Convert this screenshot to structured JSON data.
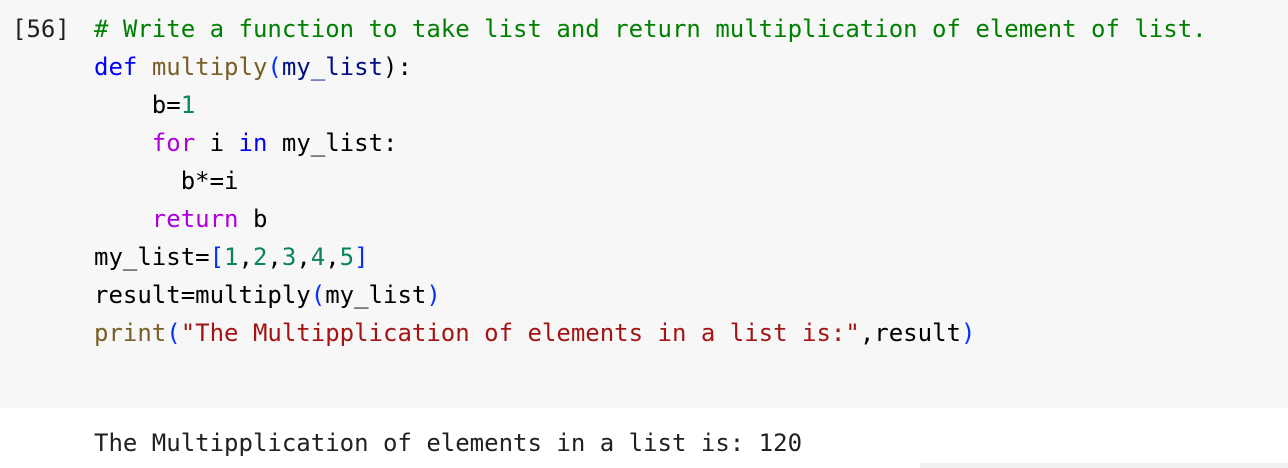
{
  "cell": {
    "execution_count": "[56]",
    "lines": [
      [
        {
          "t": "# Write a function to take list and return multiplication of element of list.",
          "c": "comment"
        }
      ],
      [
        {
          "t": "def",
          "c": "kw-def"
        },
        {
          "t": " ",
          "c": "plain"
        },
        {
          "t": "multiply",
          "c": "fn"
        },
        {
          "t": "(",
          "c": "punct"
        },
        {
          "t": "my_list",
          "c": "var"
        },
        {
          "t": "):",
          "c": "plain"
        }
      ],
      [
        {
          "t": "    ",
          "c": "plain"
        },
        {
          "t": "b",
          "c": "plain"
        },
        {
          "t": "=",
          "c": "plain"
        },
        {
          "t": "1",
          "c": "num"
        }
      ],
      [
        {
          "t": "    ",
          "c": "plain"
        },
        {
          "t": "for",
          "c": "kw-flow"
        },
        {
          "t": " i ",
          "c": "plain"
        },
        {
          "t": "in",
          "c": "kw-def"
        },
        {
          "t": " my_list:",
          "c": "plain"
        }
      ],
      [
        {
          "t": "      ",
          "c": "plain"
        },
        {
          "t": "b*=i",
          "c": "plain"
        }
      ],
      [
        {
          "t": "    ",
          "c": "plain"
        },
        {
          "t": "return",
          "c": "kw-flow"
        },
        {
          "t": " b",
          "c": "plain"
        }
      ],
      [
        {
          "t": "my_list=",
          "c": "plain"
        },
        {
          "t": "[",
          "c": "punct"
        },
        {
          "t": "1",
          "c": "num"
        },
        {
          "t": ",",
          "c": "plain"
        },
        {
          "t": "2",
          "c": "num"
        },
        {
          "t": ",",
          "c": "plain"
        },
        {
          "t": "3",
          "c": "num"
        },
        {
          "t": ",",
          "c": "plain"
        },
        {
          "t": "4",
          "c": "num"
        },
        {
          "t": ",",
          "c": "plain"
        },
        {
          "t": "5",
          "c": "num"
        },
        {
          "t": "]",
          "c": "punct"
        }
      ],
      [
        {
          "t": "result=multiply",
          "c": "plain"
        },
        {
          "t": "(",
          "c": "punct"
        },
        {
          "t": "my_list",
          "c": "plain"
        },
        {
          "t": ")",
          "c": "punct"
        }
      ],
      [
        {
          "t": "print",
          "c": "fn"
        },
        {
          "t": "(",
          "c": "punct"
        },
        {
          "t": "\"The Multipplication of elements in a list is:\"",
          "c": "str"
        },
        {
          "t": ",result",
          "c": "plain"
        },
        {
          "t": ")",
          "c": "punct"
        }
      ]
    ]
  },
  "output": {
    "text": "The Multipplication of elements in a list is: 120"
  },
  "colors": {
    "cell_background": "#f7f7f7",
    "comment": "#008000",
    "keyword": "#0000ff",
    "control_keyword": "#af00db",
    "function": "#795e26",
    "string": "#a31515",
    "number": "#098658"
  }
}
